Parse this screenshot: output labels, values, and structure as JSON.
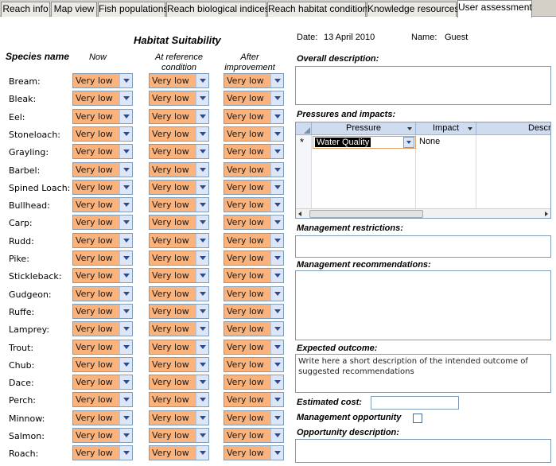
{
  "tabs": [
    {
      "label": "Reach info"
    },
    {
      "label": "Map view"
    },
    {
      "label": "Fish populations"
    },
    {
      "label": "Reach biological indices"
    },
    {
      "label": "Reach habitat condition"
    },
    {
      "label": "Knowledge resources"
    },
    {
      "label": "User assessment"
    }
  ],
  "habitat": {
    "title": "Habitat Suitability",
    "species_header": "Species name",
    "col_now": "Now",
    "col_reference": "At reference condition",
    "col_after": "After improvement"
  },
  "species": [
    {
      "name": "Bream:",
      "now": "Very low",
      "reference": "Very low",
      "after": "Very low"
    },
    {
      "name": "Bleak:",
      "now": "Very low",
      "reference": "Very low",
      "after": "Very low"
    },
    {
      "name": "Eel:",
      "now": "Very low",
      "reference": "Very low",
      "after": "Very low"
    },
    {
      "name": "Stoneloach:",
      "now": "Very low",
      "reference": "Very low",
      "after": "Very low"
    },
    {
      "name": "Grayling:",
      "now": "Very low",
      "reference": "Very low",
      "after": "Very low"
    },
    {
      "name": "Barbel:",
      "now": "Very low",
      "reference": "Very low",
      "after": "Very low"
    },
    {
      "name": "Spined Loach:",
      "now": "Very low",
      "reference": "Very low",
      "after": "Very low"
    },
    {
      "name": "Bullhead:",
      "now": "Very low",
      "reference": "Very low",
      "after": "Very low"
    },
    {
      "name": "Carp:",
      "now": "Very low",
      "reference": "Very low",
      "after": "Very low"
    },
    {
      "name": "Rudd:",
      "now": "Very low",
      "reference": "Very low",
      "after": "Very low"
    },
    {
      "name": "Pike:",
      "now": "Very low",
      "reference": "Very low",
      "after": "Very low"
    },
    {
      "name": "Stickleback:",
      "now": "Very low",
      "reference": "Very low",
      "after": "Very low"
    },
    {
      "name": "Gudgeon:",
      "now": "Very low",
      "reference": "Very low",
      "after": "Very low"
    },
    {
      "name": "Ruffe:",
      "now": "Very low",
      "reference": "Very low",
      "after": "Very low"
    },
    {
      "name": "Lamprey:",
      "now": "Very low",
      "reference": "Very low",
      "after": "Very low"
    },
    {
      "name": "Trout:",
      "now": "Very low",
      "reference": "Very low",
      "after": "Very low"
    },
    {
      "name": "Chub:",
      "now": "Very low",
      "reference": "Very low",
      "after": "Very low"
    },
    {
      "name": "Dace:",
      "now": "Very low",
      "reference": "Very low",
      "after": "Very low"
    },
    {
      "name": "Perch:",
      "now": "Very low",
      "reference": "Very low",
      "after": "Very low"
    },
    {
      "name": "Minnow:",
      "now": "Very low",
      "reference": "Very low",
      "after": "Very low"
    },
    {
      "name": "Salmon:",
      "now": "Very low",
      "reference": "Very low",
      "after": "Very low"
    },
    {
      "name": "Roach:",
      "now": "Very low",
      "reference": "Very low",
      "after": "Very low"
    }
  ],
  "header": {
    "date_label": "Date:",
    "date_value": "13 April 2010",
    "name_label": "Name:",
    "name_value": "Guest"
  },
  "form": {
    "overall_description_label": "Overall description:",
    "pressures_label": "Pressures and impacts:",
    "management_restrictions_label": "Management restrictions:",
    "management_recommendations_label": "Management recommendations:",
    "expected_outcome_label": "Expected outcome:",
    "expected_outcome_value": "Write here a short description of the intended outcome of suggested recommendations",
    "estimated_cost_label": "Estimated cost:",
    "management_opportunity_label": "Management opportunity",
    "opportunity_description_label": "Opportunity description:"
  },
  "pressures_grid": {
    "columns": [
      "Pressure",
      "Impact",
      "Descr"
    ],
    "new_row_marker": "*",
    "rows": [
      {
        "pressure": "Water Quality",
        "impact": "None",
        "description": ""
      }
    ]
  },
  "colors": {
    "combo_fill": "#fbb27b",
    "active_tab": "#ffffff",
    "grid_header": "#cfdcef",
    "selected_cell": "#000000"
  }
}
